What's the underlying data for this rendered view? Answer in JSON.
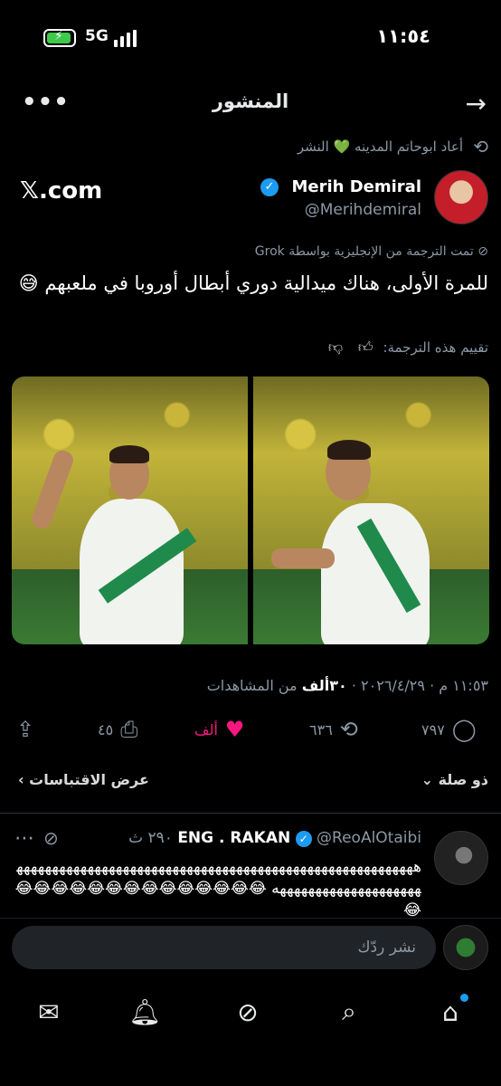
{
  "status_bar": {
    "time": "١١:٥٤",
    "network": "5G",
    "battery_color": "#3ec94b"
  },
  "header": {
    "title": "المنشور",
    "more_icon": "more-icon",
    "back_icon": "arrow-right-icon"
  },
  "repost": {
    "text": "أعاد ابوحاتم المدينه 💚 النشر",
    "icon": "repost-icon"
  },
  "author": {
    "name": "Merih Demiral",
    "handle": "@Merihdemiral",
    "verified_color": "#1d9bf0"
  },
  "watermark": "𝕏.com",
  "translation_note": "تمت الترجمة من الإنجليزية بواسطة Grok",
  "post": {
    "text": "للمرة الأولى، هناك ميدالية دوري أبطال أوروبا في ملعبهم 😅",
    "rate_label": "تقييم هذه الترجمة:",
    "datetime": "١١:٥٣ م · ٢٠٢٦/٤/٢٩ ·",
    "views_count": "٣٠ألف",
    "views_label": "من المشاهدات"
  },
  "actions": {
    "replies": "٧٩٧",
    "reposts": "٦٣٦",
    "likes": "ألف",
    "bookmarks": "٤٥",
    "like_color": "#f91880"
  },
  "sub": {
    "related": "ذو صلة",
    "quotes": "عرض الاقتباسات"
  },
  "reply": {
    "name": "ENG . RAKAN",
    "handle": "@ReoAlOtaibi",
    "age": "٢٩٠ ث",
    "text": "هههههههههههههههههههههههههههههههههههههههههههههههههههههههههههههههههههههههههههههه 😂😂😂😂😂😂😂😂😂😂😂😂😂😂😂"
  },
  "composer": {
    "placeholder": "نشر ردّك"
  },
  "tabs": [
    "home-icon",
    "search-icon",
    "grok-icon",
    "notifications-icon",
    "messages-icon"
  ],
  "accent_color": "#1d9bf0"
}
